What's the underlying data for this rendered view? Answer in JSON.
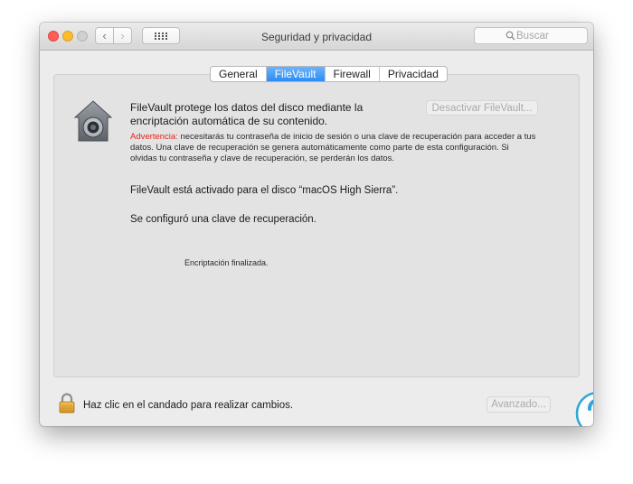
{
  "window": {
    "title": "Seguridad y privacidad",
    "search_placeholder": "Buscar"
  },
  "tabs": [
    {
      "label": "General",
      "active": false
    },
    {
      "label": "FileVault",
      "active": true
    },
    {
      "label": "Firewall",
      "active": false
    },
    {
      "label": "Privacidad",
      "active": false
    }
  ],
  "filevault": {
    "heading": "FileVault protege los datos del disco mediante la encriptación automática de su contenido.",
    "deactivate_button": "Desactivar FileVault...",
    "warning_label": "Advertencia:",
    "warning_text": " necesitarás tu contraseña de inicio de sesión o una clave de recuperación para acceder a tus datos. Una clave de recuperación se genera automáticamente como parte de esta configuración. Si olvidas tu contraseña y clave de recuperación, se perderán los datos.",
    "status_enabled": "FileVault está activado para el disco “macOS High Sierra”.",
    "status_recovery": "Se configuró una clave de recuperación.",
    "status_encryption": "Encriptación finalizada."
  },
  "footer": {
    "lock_text": "Haz clic en el candado para realizar cambios.",
    "advanced_button": "Avanzado...",
    "help_label": "?"
  },
  "colors": {
    "accent": "#2a8cf7",
    "warning": "#e0251b",
    "watermark": "#2fa6d6"
  },
  "icons": {
    "house": "filevault-house-icon",
    "padlock": "padlock-icon",
    "search": "search-icon"
  }
}
